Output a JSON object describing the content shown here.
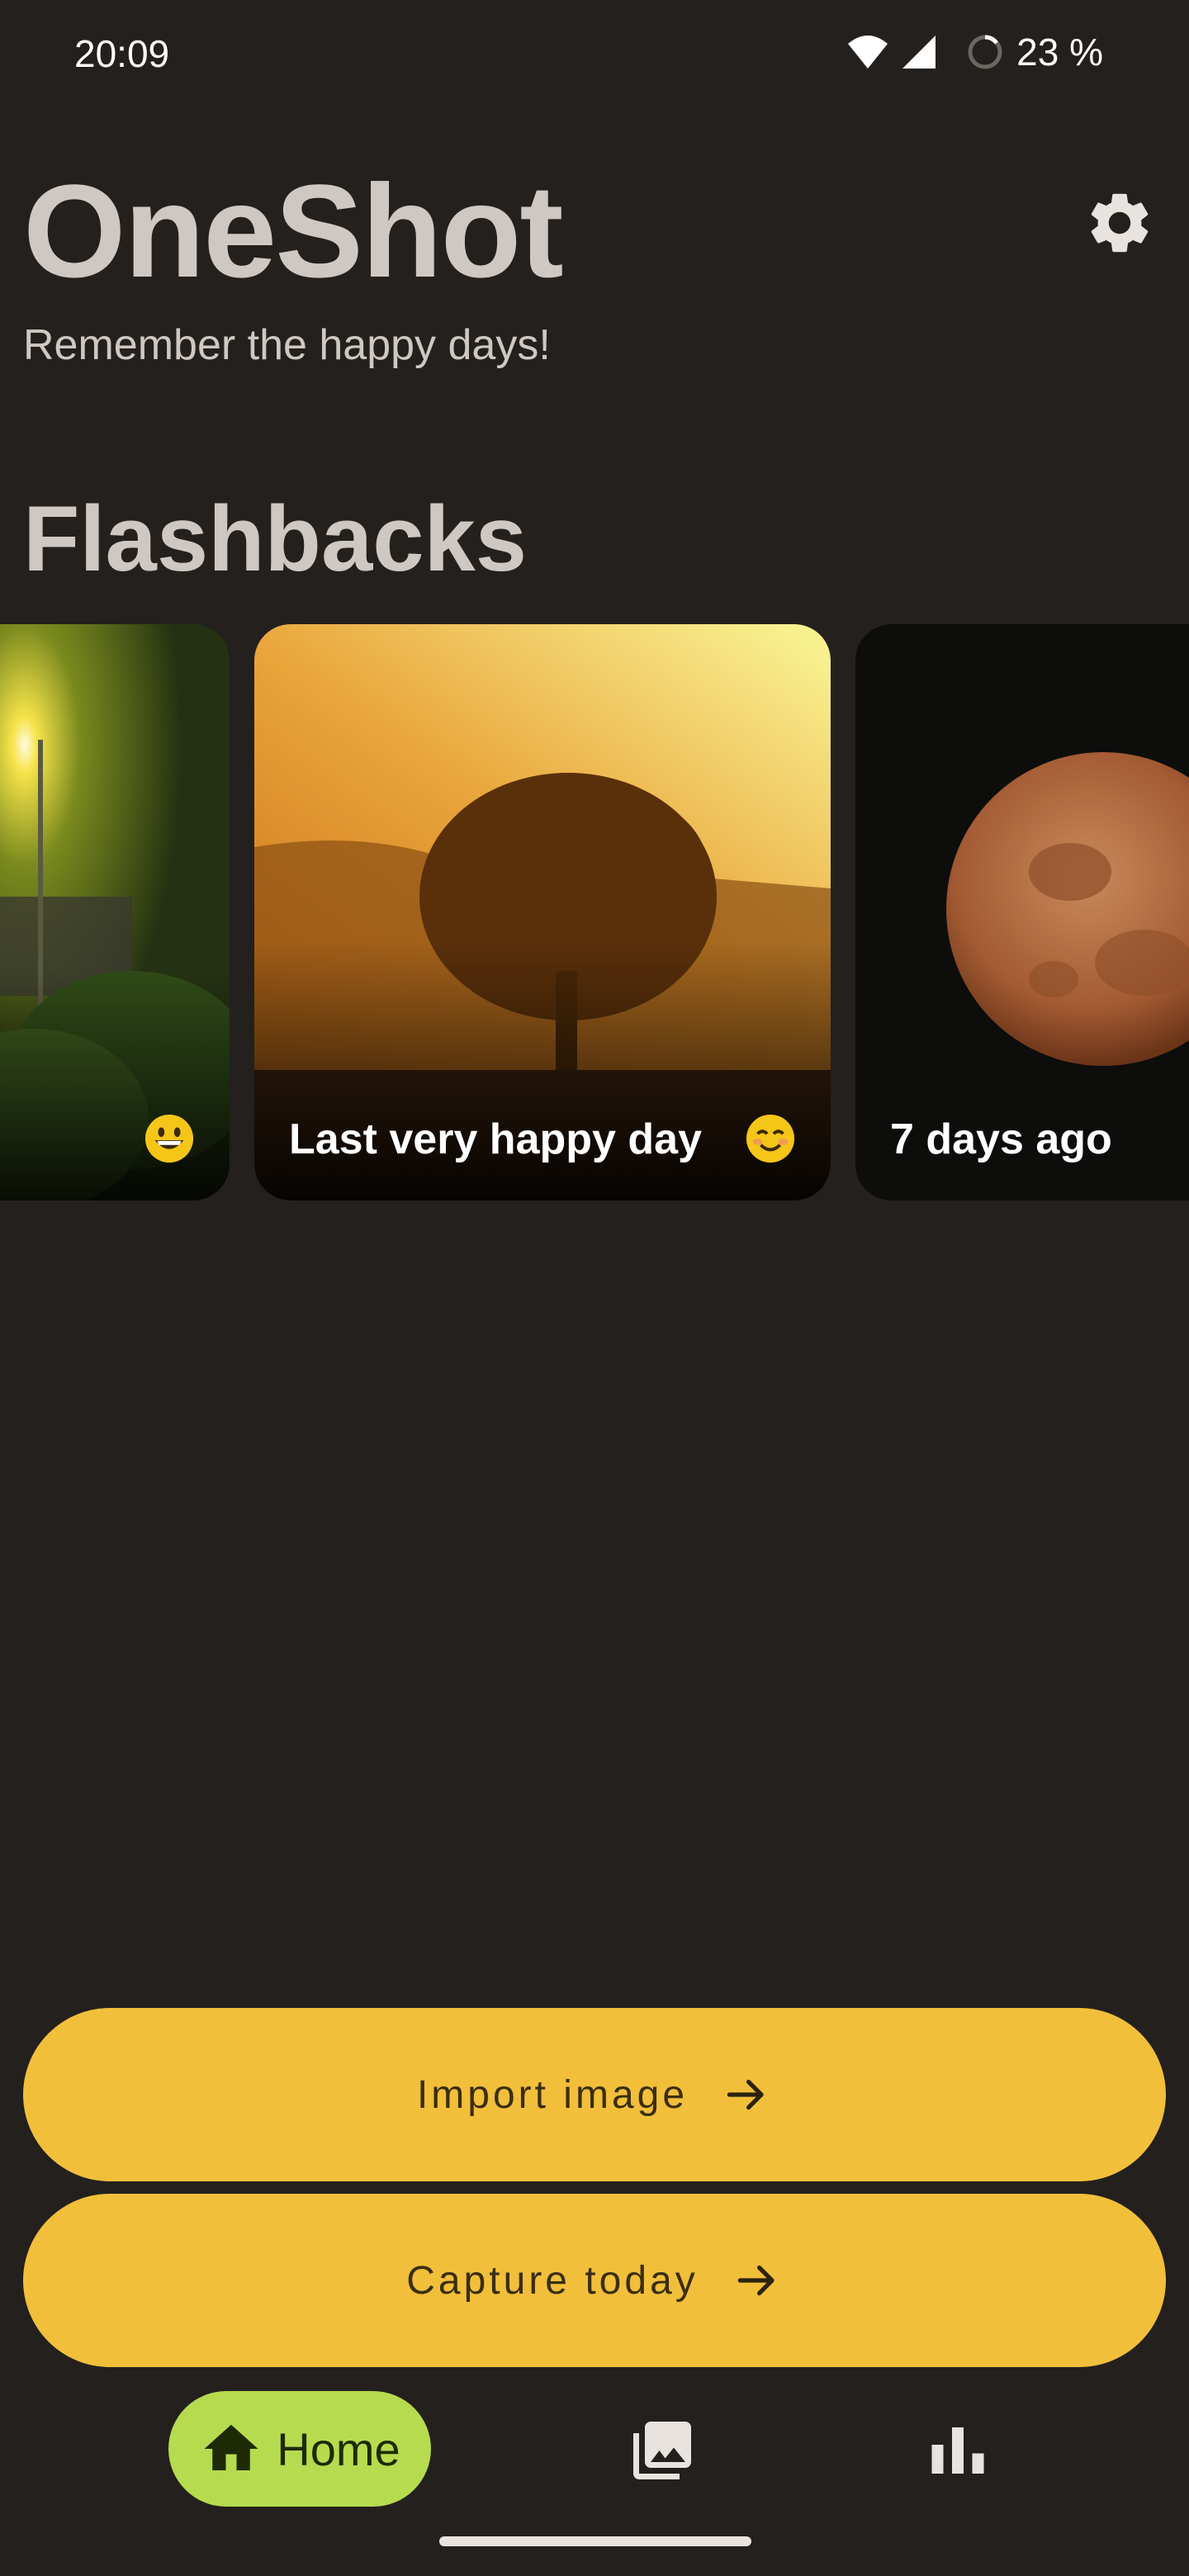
{
  "status_bar": {
    "time": "20:09",
    "battery": "23 %",
    "icons": [
      "wifi-icon",
      "cellular-signal-icon",
      "battery-saver-icon"
    ]
  },
  "header": {
    "title": "OneShot",
    "subtitle": "Remember the happy days!",
    "settings_icon": "gear-icon"
  },
  "flashbacks": {
    "title": "Flashbacks",
    "cards": [
      {
        "caption": "",
        "emoji": "grinning-face-emoji",
        "photo": "sunset through trees by a pond"
      },
      {
        "caption": "Last very happy day",
        "emoji": "smiling-face-emoji",
        "photo": "tree silhouette at golden hour"
      },
      {
        "caption": "7 days ago",
        "emoji": "",
        "photo": "orange full moon"
      }
    ]
  },
  "actions": {
    "import_label": "Import image",
    "capture_label": "Capture today"
  },
  "bottom_nav": {
    "home_label": "Home",
    "items": [
      "home-icon",
      "gallery-icon",
      "statistics-icon"
    ]
  },
  "colors": {
    "background": "#23201d",
    "accent": "#f2bf3b",
    "nav_active": "#b6db4f",
    "text": "#cfc8c2"
  }
}
